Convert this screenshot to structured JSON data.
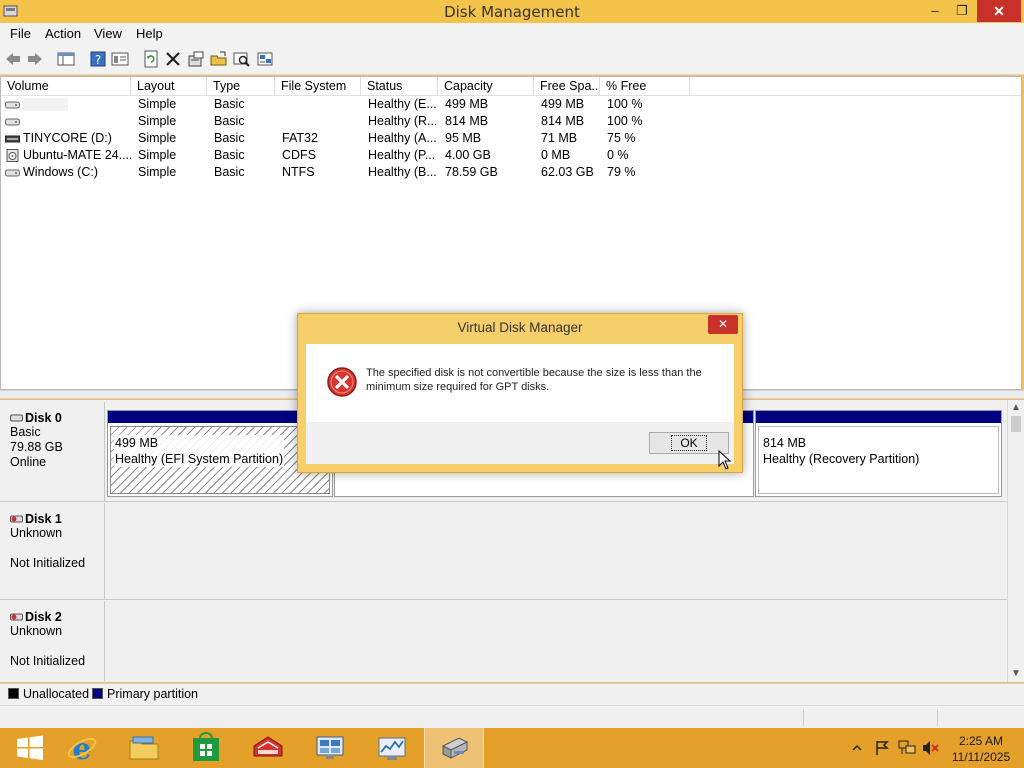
{
  "window": {
    "title": "Disk Management",
    "controls": {
      "minimize": "–",
      "maximize": "❐",
      "close": "✕"
    }
  },
  "menu": [
    "File",
    "Action",
    "View",
    "Help"
  ],
  "toolbar": {
    "icons": [
      "back-icon",
      "forward-icon",
      "console-tree-icon",
      "help-icon",
      "properties-icon",
      "refresh-icon",
      "delete-icon",
      "settings-icon",
      "open-icon",
      "search-icon",
      "wizard-icon"
    ]
  },
  "volumes": {
    "columns": [
      "Volume",
      "Layout",
      "Type",
      "File System",
      "Status",
      "Capacity",
      "Free Spa...",
      "% Free"
    ],
    "rows": [
      {
        "volume": "",
        "layout": "Simple",
        "type": "Basic",
        "fs": "",
        "status": "Healthy (E...",
        "capacity": "499 MB",
        "free": "499 MB",
        "pct": "100 %"
      },
      {
        "volume": "",
        "layout": "Simple",
        "type": "Basic",
        "fs": "",
        "status": "Healthy (R...",
        "capacity": "814 MB",
        "free": "814 MB",
        "pct": "100 %"
      },
      {
        "volume": "TINYCORE (D:)",
        "layout": "Simple",
        "type": "Basic",
        "fs": "FAT32",
        "status": "Healthy (A...",
        "capacity": "95 MB",
        "free": "71 MB",
        "pct": "75 %"
      },
      {
        "volume": "Ubuntu-MATE 24....",
        "layout": "Simple",
        "type": "Basic",
        "fs": "CDFS",
        "status": "Healthy (P...",
        "capacity": "4.00 GB",
        "free": "0 MB",
        "pct": "0 %"
      },
      {
        "volume": "Windows (C:)",
        "layout": "Simple",
        "type": "Basic",
        "fs": "NTFS",
        "status": "Healthy (B...",
        "capacity": "78.59 GB",
        "free": "62.03 GB",
        "pct": "79 %"
      }
    ]
  },
  "disks": [
    {
      "name": "Disk 0",
      "type": "Basic",
      "size": "79.88 GB",
      "state": "Online",
      "partitions": [
        {
          "size": "499 MB",
          "status": "Healthy (EFI System Partition)"
        },
        {
          "size": "",
          "status": ""
        },
        {
          "size": "814 MB",
          "status": "Healthy (Recovery Partition)"
        }
      ]
    },
    {
      "name": "Disk 1",
      "type": "Unknown",
      "size": "",
      "state": "Not Initialized"
    },
    {
      "name": "Disk 2",
      "type": "Unknown",
      "size": "",
      "state": "Not Initialized"
    }
  ],
  "legend": [
    {
      "label": "Unallocated",
      "color": "#000000"
    },
    {
      "label": "Primary partition",
      "color": "#000080"
    }
  ],
  "dialog": {
    "title": "Virtual Disk Manager",
    "close": "✕",
    "message": "The specified disk is not convertible because the size is less than the minimum size required for GPT disks.",
    "ok_label": "OK",
    "icon": "error-icon"
  },
  "taskbar": {
    "apps": [
      "start-icon",
      "internet-explorer-icon",
      "file-explorer-icon",
      "store-icon",
      "toolbox-icon",
      "server-manager-icon",
      "performance-monitor-icon",
      "computer-management-icon"
    ],
    "tray_icons": [
      "show-hidden-icon",
      "action-center-icon",
      "network-icon",
      "volume-muted-icon"
    ],
    "time": "2:25 AM",
    "date": "11/11/2025"
  },
  "colors": {
    "titlebar": "#f4c44a",
    "taskbar": "#e5a02a",
    "primary_partition": "#000080",
    "close_button": "#c7312a"
  }
}
